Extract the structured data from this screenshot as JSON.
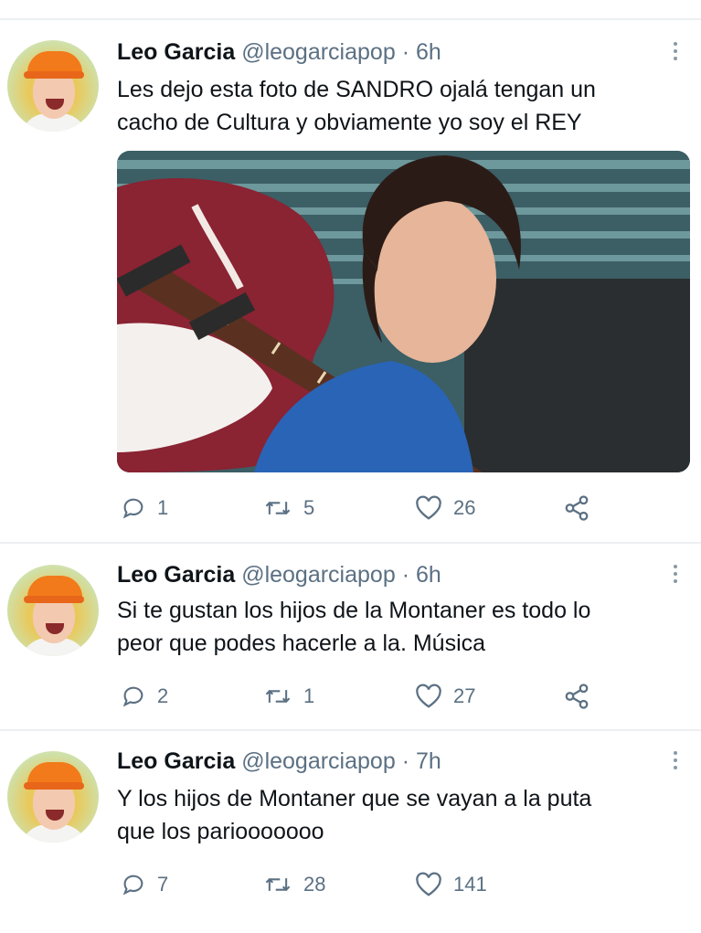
{
  "tweets": [
    {
      "name": "Leo Garcia",
      "handle": "@leogarciapop",
      "time": "· 6h",
      "lines": [
        "Les dejo esta foto de SANDRO ojalá tengan un",
        "cacho de Cultura y obviamente yo soy el REY"
      ],
      "replies": "1",
      "retweets": "5",
      "likes": "26",
      "share": true
    },
    {
      "name": "Leo Garcia",
      "handle": "@leogarciapop",
      "time": "· 6h",
      "lines": [
        "Si te gustan los hijos de la Montaner es todo lo",
        "peor que podes hacerle a la. Música"
      ],
      "replies": "2",
      "retweets": "1",
      "likes": "27",
      "share": true
    },
    {
      "name": "Leo Garcia",
      "handle": "@leogarciapop",
      "time": "· 7h",
      "lines": [
        "Y los hijos de Montaner que se vayan a la puta",
        "que los pariooooooo"
      ],
      "replies": "7",
      "retweets": "28",
      "likes": "141",
      "share": false
    }
  ],
  "colors": {
    "text": "#0f1419",
    "secondary": "#5b7083",
    "divider": "#eceff1"
  }
}
